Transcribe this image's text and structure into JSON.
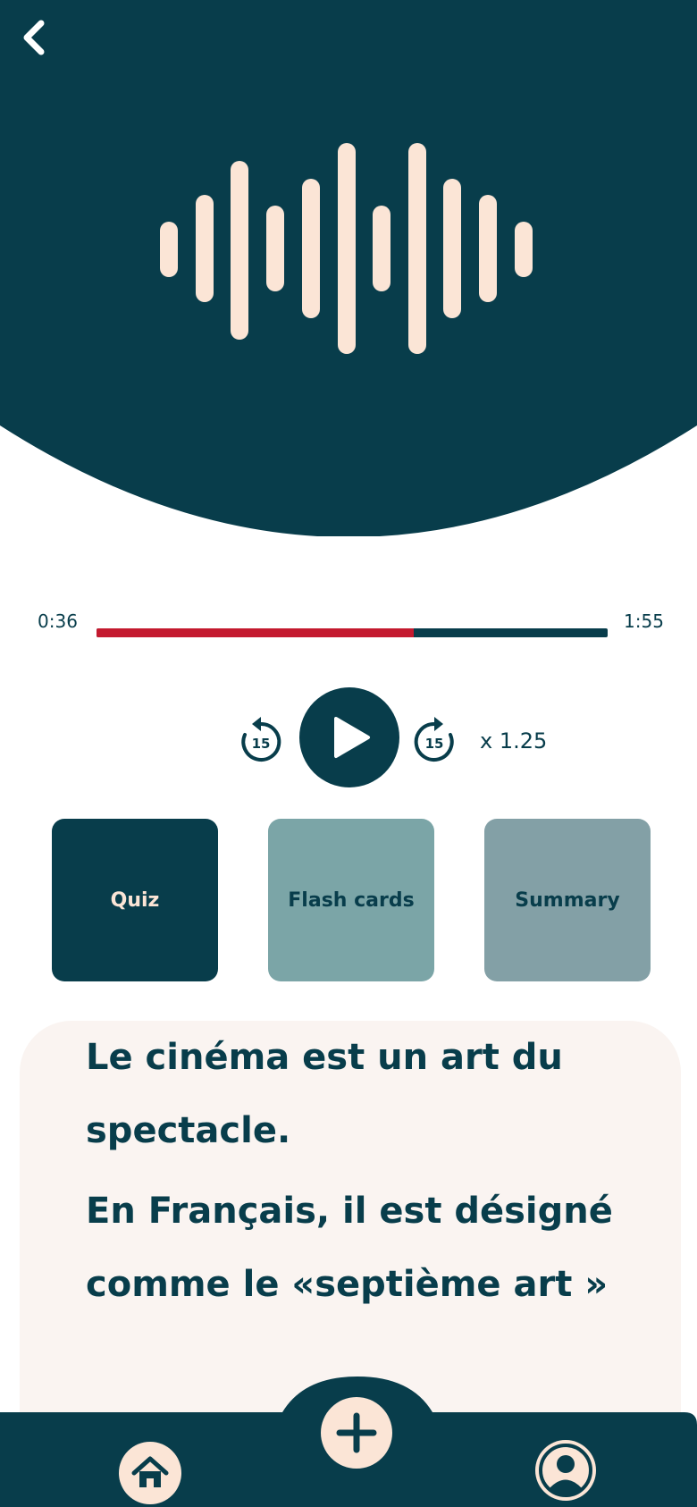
{
  "player": {
    "current_time": "0:36",
    "total_time": "1:55",
    "progress": 0.62,
    "skip_back": "15",
    "skip_forward": "15",
    "speed": "x 1.25"
  },
  "cards": {
    "quiz": "Quiz",
    "flash": "Flash cards",
    "summary": "Summary"
  },
  "transcript": {
    "line1": "Le cinéma est un art du spectacle.",
    "line2": "En Français, il est désigné comme le «septième art »"
  },
  "icons": {
    "back": "chevron-left-icon",
    "waveform": "waveform-icon",
    "play": "play-icon",
    "rewind": "rewind-15-icon",
    "forward": "forward-15-icon",
    "home": "home-icon",
    "add": "plus-icon",
    "profile": "user-icon"
  },
  "colors": {
    "primary": "#083d4b",
    "accent": "#c41a2f",
    "cream": "#fbe5d6",
    "transcript_bg": "#faf4f1",
    "flash_bg": "#7ba5a7",
    "summary_bg": "#83a0a6"
  }
}
